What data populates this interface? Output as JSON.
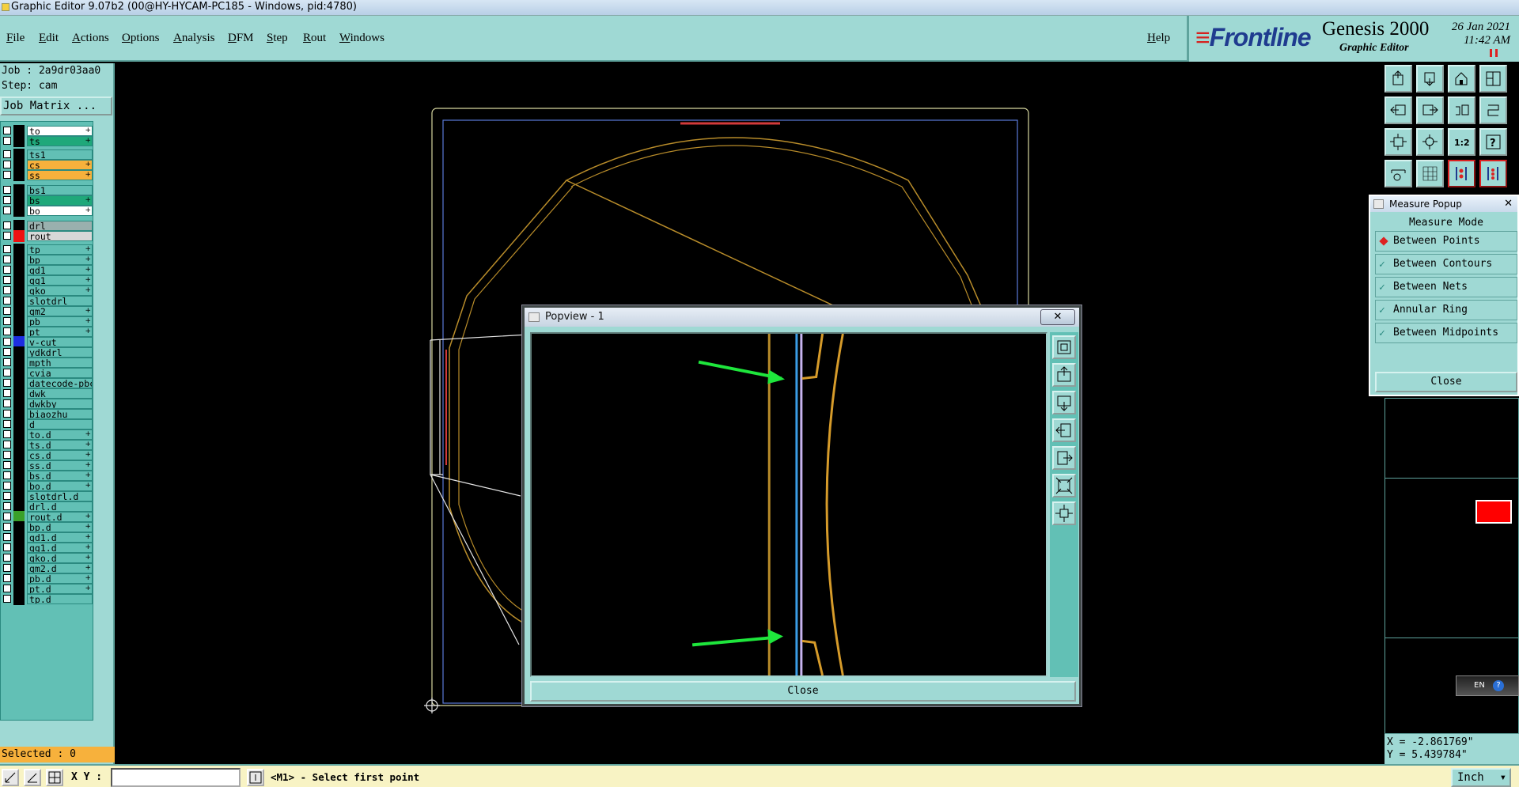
{
  "window": {
    "title": "Graphic Editor 9.07b2 (00@HY-HYCAM-PC185 - Windows, pid:4780)"
  },
  "menu": {
    "items": [
      "File",
      "Edit",
      "Actions",
      "Options",
      "Analysis",
      "DFM",
      "Step",
      "Rout",
      "Windows"
    ],
    "help": "Help"
  },
  "brand": {
    "logo": "Frontline",
    "product": "Genesis 2000",
    "subtitle": "Graphic Editor",
    "date": "26 Jan 2021",
    "time": "11:42 AM"
  },
  "left": {
    "job": "Job : 2a9dr03aa0",
    "step": "Step: cam",
    "job_matrix": "Job Matrix ...",
    "selected": "Selected : 0"
  },
  "layers": [
    {
      "name": "to",
      "color": "#ffffff",
      "sig": "+"
    },
    {
      "name": "ts",
      "color": "#1fa87a",
      "sig": "+"
    },
    {
      "name": "ts1",
      "color": "#62c0b5",
      "sig": ""
    },
    {
      "name": "cs",
      "color": "#f7b13c",
      "sig": "+"
    },
    {
      "name": "ss",
      "color": "#f7b13c",
      "sig": "+"
    },
    {
      "name": "bs1",
      "color": "#62c0b5",
      "sig": ""
    },
    {
      "name": "bs",
      "color": "#1fa87a",
      "sig": "+"
    },
    {
      "name": "bo",
      "color": "#ffffff",
      "sig": "+"
    },
    {
      "name": "drl",
      "color": "#9ab0ae",
      "sig": ""
    },
    {
      "name": "rout",
      "color": "#d8d8d8",
      "sig": ""
    },
    {
      "name": "tp",
      "color": "#62c0b5",
      "sig": "+"
    },
    {
      "name": "bp",
      "color": "#62c0b5",
      "sig": "+"
    },
    {
      "name": "gd1",
      "color": "#62c0b5",
      "sig": "+"
    },
    {
      "name": "gg1",
      "color": "#62c0b5",
      "sig": "+"
    },
    {
      "name": "gko",
      "color": "#62c0b5",
      "sig": "+"
    },
    {
      "name": "slotdrl",
      "color": "#62c0b5",
      "sig": ""
    },
    {
      "name": "gm2",
      "color": "#62c0b5",
      "sig": "+"
    },
    {
      "name": "pb",
      "color": "#62c0b5",
      "sig": "+"
    },
    {
      "name": "pt",
      "color": "#62c0b5",
      "sig": "+"
    },
    {
      "name": "v-cut",
      "color": "#62c0b5",
      "sig": ""
    },
    {
      "name": "ydkdrl",
      "color": "#62c0b5",
      "sig": ""
    },
    {
      "name": "mpth",
      "color": "#62c0b5",
      "sig": ""
    },
    {
      "name": "cvia",
      "color": "#62c0b5",
      "sig": ""
    },
    {
      "name": "datecode-pbc",
      "color": "#62c0b5",
      "sig": ""
    },
    {
      "name": "dwk",
      "color": "#62c0b5",
      "sig": ""
    },
    {
      "name": "dwkby",
      "color": "#62c0b5",
      "sig": ""
    },
    {
      "name": "biaozhu",
      "color": "#62c0b5",
      "sig": ""
    },
    {
      "name": "d",
      "color": "#62c0b5",
      "sig": ""
    },
    {
      "name": "to.d",
      "color": "#62c0b5",
      "sig": "+"
    },
    {
      "name": "ts.d",
      "color": "#62c0b5",
      "sig": "+"
    },
    {
      "name": "cs.d",
      "color": "#62c0b5",
      "sig": "+"
    },
    {
      "name": "ss.d",
      "color": "#62c0b5",
      "sig": "+"
    },
    {
      "name": "bs.d",
      "color": "#62c0b5",
      "sig": "+"
    },
    {
      "name": "bo.d",
      "color": "#62c0b5",
      "sig": "+"
    },
    {
      "name": "slotdrl.d",
      "color": "#62c0b5",
      "sig": ""
    },
    {
      "name": "drl.d",
      "color": "#62c0b5",
      "sig": ""
    },
    {
      "name": "rout.d",
      "color": "#62c0b5",
      "sig": "+"
    },
    {
      "name": "bp.d",
      "color": "#62c0b5",
      "sig": "+"
    },
    {
      "name": "gd1.d",
      "color": "#62c0b5",
      "sig": "+"
    },
    {
      "name": "gg1.d",
      "color": "#62c0b5",
      "sig": "+"
    },
    {
      "name": "gko.d",
      "color": "#62c0b5",
      "sig": "+"
    },
    {
      "name": "gm2.d",
      "color": "#62c0b5",
      "sig": "+"
    },
    {
      "name": "pb.d",
      "color": "#62c0b5",
      "sig": "+"
    },
    {
      "name": "pt.d",
      "color": "#62c0b5",
      "sig": "+"
    },
    {
      "name": "tp.d",
      "color": "#62c0b5",
      "sig": ""
    }
  ],
  "measure": {
    "title": "Measure Popup",
    "header": "Measure Mode",
    "options": [
      "Between Points",
      "Between Contours",
      "Between Nets",
      "Annular Ring",
      "Between Midpoints"
    ],
    "selected_option": "Between Points",
    "close": "Close"
  },
  "popview": {
    "title": "Popview - 1",
    "close_x": "✕",
    "close": "Close"
  },
  "coords": {
    "x": "X = -2.861769\"",
    "y": "Y = 5.439784\""
  },
  "language": {
    "code": "EN",
    "help": "?"
  },
  "status": {
    "xy_label": "X Y :",
    "xy_value": "",
    "prompt": "<M1> - Select first point",
    "units": "Inch"
  }
}
